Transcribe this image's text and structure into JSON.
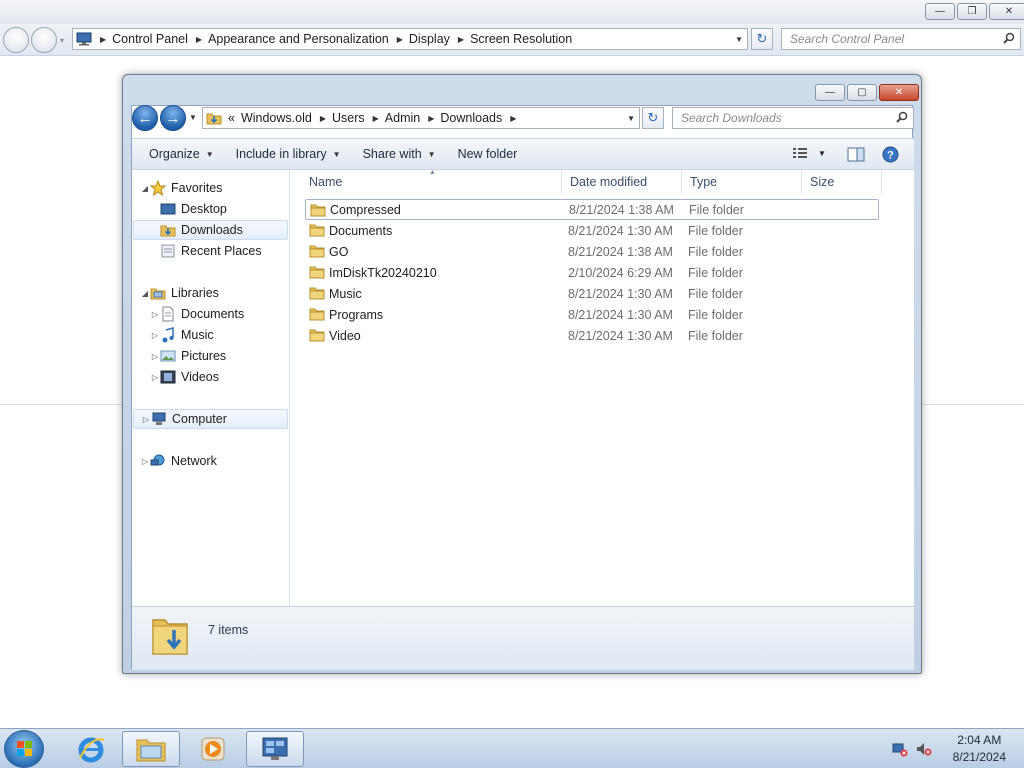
{
  "background_window": {
    "breadcrumb": [
      "Control Panel",
      "Appearance and Personalization",
      "Display",
      "Screen Resolution"
    ],
    "search_placeholder": "Search Control Panel"
  },
  "explorer": {
    "breadcrumb_prefix": "«",
    "breadcrumb": [
      "Windows.old",
      "Users",
      "Admin",
      "Downloads"
    ],
    "search_placeholder": "Search Downloads",
    "toolbar": {
      "organize": "Organize",
      "include_in_library": "Include in library",
      "share_with": "Share with",
      "new_folder": "New folder"
    },
    "sidebar": {
      "favorites": "Favorites",
      "favorites_items": [
        "Desktop",
        "Downloads",
        "Recent Places"
      ],
      "libraries": "Libraries",
      "libraries_items": [
        "Documents",
        "Music",
        "Pictures",
        "Videos"
      ],
      "computer": "Computer",
      "network": "Network"
    },
    "columns": {
      "name": "Name",
      "date_modified": "Date modified",
      "type": "Type",
      "size": "Size"
    },
    "files": [
      {
        "name": "Compressed",
        "date": "8/21/2024 1:38 AM",
        "type": "File folder"
      },
      {
        "name": "Documents",
        "date": "8/21/2024 1:30 AM",
        "type": "File folder"
      },
      {
        "name": "GO",
        "date": "8/21/2024 1:38 AM",
        "type": "File folder"
      },
      {
        "name": "ImDiskTk20240210",
        "date": "2/10/2024 6:29 AM",
        "type": "File folder"
      },
      {
        "name": "Music",
        "date": "8/21/2024 1:30 AM",
        "type": "File folder"
      },
      {
        "name": "Programs",
        "date": "8/21/2024 1:30 AM",
        "type": "File folder"
      },
      {
        "name": "Video",
        "date": "8/21/2024 1:30 AM",
        "type": "File folder"
      }
    ],
    "status": "7 items"
  },
  "taskbar": {
    "time": "2:04 AM",
    "date": "8/21/2024"
  },
  "colors": {
    "folder_yellow": "#e8c05a",
    "accent_blue": "#2f73b8"
  }
}
